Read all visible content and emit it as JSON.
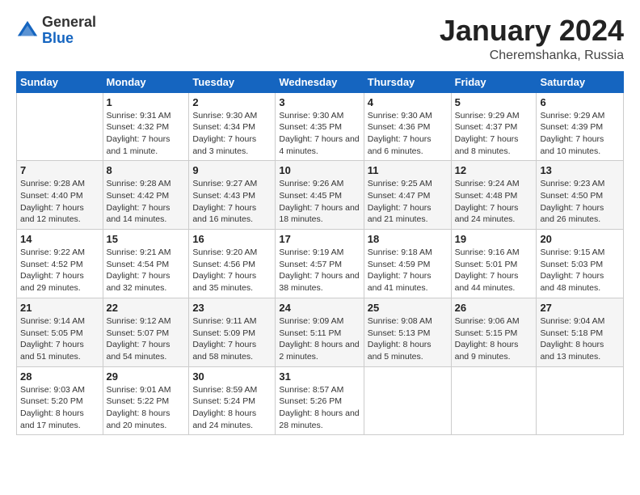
{
  "header": {
    "logo_general": "General",
    "logo_blue": "Blue",
    "title": "January 2024",
    "location": "Cheremshanka, Russia"
  },
  "weekdays": [
    "Sunday",
    "Monday",
    "Tuesday",
    "Wednesday",
    "Thursday",
    "Friday",
    "Saturday"
  ],
  "weeks": [
    [
      {
        "day": "",
        "sunrise": "",
        "sunset": "",
        "daylight": ""
      },
      {
        "day": "1",
        "sunrise": "Sunrise: 9:31 AM",
        "sunset": "Sunset: 4:32 PM",
        "daylight": "Daylight: 7 hours and 1 minute."
      },
      {
        "day": "2",
        "sunrise": "Sunrise: 9:30 AM",
        "sunset": "Sunset: 4:34 PM",
        "daylight": "Daylight: 7 hours and 3 minutes."
      },
      {
        "day": "3",
        "sunrise": "Sunrise: 9:30 AM",
        "sunset": "Sunset: 4:35 PM",
        "daylight": "Daylight: 7 hours and 4 minutes."
      },
      {
        "day": "4",
        "sunrise": "Sunrise: 9:30 AM",
        "sunset": "Sunset: 4:36 PM",
        "daylight": "Daylight: 7 hours and 6 minutes."
      },
      {
        "day": "5",
        "sunrise": "Sunrise: 9:29 AM",
        "sunset": "Sunset: 4:37 PM",
        "daylight": "Daylight: 7 hours and 8 minutes."
      },
      {
        "day": "6",
        "sunrise": "Sunrise: 9:29 AM",
        "sunset": "Sunset: 4:39 PM",
        "daylight": "Daylight: 7 hours and 10 minutes."
      }
    ],
    [
      {
        "day": "7",
        "sunrise": "Sunrise: 9:28 AM",
        "sunset": "Sunset: 4:40 PM",
        "daylight": "Daylight: 7 hours and 12 minutes."
      },
      {
        "day": "8",
        "sunrise": "Sunrise: 9:28 AM",
        "sunset": "Sunset: 4:42 PM",
        "daylight": "Daylight: 7 hours and 14 minutes."
      },
      {
        "day": "9",
        "sunrise": "Sunrise: 9:27 AM",
        "sunset": "Sunset: 4:43 PM",
        "daylight": "Daylight: 7 hours and 16 minutes."
      },
      {
        "day": "10",
        "sunrise": "Sunrise: 9:26 AM",
        "sunset": "Sunset: 4:45 PM",
        "daylight": "Daylight: 7 hours and 18 minutes."
      },
      {
        "day": "11",
        "sunrise": "Sunrise: 9:25 AM",
        "sunset": "Sunset: 4:47 PM",
        "daylight": "Daylight: 7 hours and 21 minutes."
      },
      {
        "day": "12",
        "sunrise": "Sunrise: 9:24 AM",
        "sunset": "Sunset: 4:48 PM",
        "daylight": "Daylight: 7 hours and 24 minutes."
      },
      {
        "day": "13",
        "sunrise": "Sunrise: 9:23 AM",
        "sunset": "Sunset: 4:50 PM",
        "daylight": "Daylight: 7 hours and 26 minutes."
      }
    ],
    [
      {
        "day": "14",
        "sunrise": "Sunrise: 9:22 AM",
        "sunset": "Sunset: 4:52 PM",
        "daylight": "Daylight: 7 hours and 29 minutes."
      },
      {
        "day": "15",
        "sunrise": "Sunrise: 9:21 AM",
        "sunset": "Sunset: 4:54 PM",
        "daylight": "Daylight: 7 hours and 32 minutes."
      },
      {
        "day": "16",
        "sunrise": "Sunrise: 9:20 AM",
        "sunset": "Sunset: 4:56 PM",
        "daylight": "Daylight: 7 hours and 35 minutes."
      },
      {
        "day": "17",
        "sunrise": "Sunrise: 9:19 AM",
        "sunset": "Sunset: 4:57 PM",
        "daylight": "Daylight: 7 hours and 38 minutes."
      },
      {
        "day": "18",
        "sunrise": "Sunrise: 9:18 AM",
        "sunset": "Sunset: 4:59 PM",
        "daylight": "Daylight: 7 hours and 41 minutes."
      },
      {
        "day": "19",
        "sunrise": "Sunrise: 9:16 AM",
        "sunset": "Sunset: 5:01 PM",
        "daylight": "Daylight: 7 hours and 44 minutes."
      },
      {
        "day": "20",
        "sunrise": "Sunrise: 9:15 AM",
        "sunset": "Sunset: 5:03 PM",
        "daylight": "Daylight: 7 hours and 48 minutes."
      }
    ],
    [
      {
        "day": "21",
        "sunrise": "Sunrise: 9:14 AM",
        "sunset": "Sunset: 5:05 PM",
        "daylight": "Daylight: 7 hours and 51 minutes."
      },
      {
        "day": "22",
        "sunrise": "Sunrise: 9:12 AM",
        "sunset": "Sunset: 5:07 PM",
        "daylight": "Daylight: 7 hours and 54 minutes."
      },
      {
        "day": "23",
        "sunrise": "Sunrise: 9:11 AM",
        "sunset": "Sunset: 5:09 PM",
        "daylight": "Daylight: 7 hours and 58 minutes."
      },
      {
        "day": "24",
        "sunrise": "Sunrise: 9:09 AM",
        "sunset": "Sunset: 5:11 PM",
        "daylight": "Daylight: 8 hours and 2 minutes."
      },
      {
        "day": "25",
        "sunrise": "Sunrise: 9:08 AM",
        "sunset": "Sunset: 5:13 PM",
        "daylight": "Daylight: 8 hours and 5 minutes."
      },
      {
        "day": "26",
        "sunrise": "Sunrise: 9:06 AM",
        "sunset": "Sunset: 5:15 PM",
        "daylight": "Daylight: 8 hours and 9 minutes."
      },
      {
        "day": "27",
        "sunrise": "Sunrise: 9:04 AM",
        "sunset": "Sunset: 5:18 PM",
        "daylight": "Daylight: 8 hours and 13 minutes."
      }
    ],
    [
      {
        "day": "28",
        "sunrise": "Sunrise: 9:03 AM",
        "sunset": "Sunset: 5:20 PM",
        "daylight": "Daylight: 8 hours and 17 minutes."
      },
      {
        "day": "29",
        "sunrise": "Sunrise: 9:01 AM",
        "sunset": "Sunset: 5:22 PM",
        "daylight": "Daylight: 8 hours and 20 minutes."
      },
      {
        "day": "30",
        "sunrise": "Sunrise: 8:59 AM",
        "sunset": "Sunset: 5:24 PM",
        "daylight": "Daylight: 8 hours and 24 minutes."
      },
      {
        "day": "31",
        "sunrise": "Sunrise: 8:57 AM",
        "sunset": "Sunset: 5:26 PM",
        "daylight": "Daylight: 8 hours and 28 minutes."
      },
      {
        "day": "",
        "sunrise": "",
        "sunset": "",
        "daylight": ""
      },
      {
        "day": "",
        "sunrise": "",
        "sunset": "",
        "daylight": ""
      },
      {
        "day": "",
        "sunrise": "",
        "sunset": "",
        "daylight": ""
      }
    ]
  ]
}
